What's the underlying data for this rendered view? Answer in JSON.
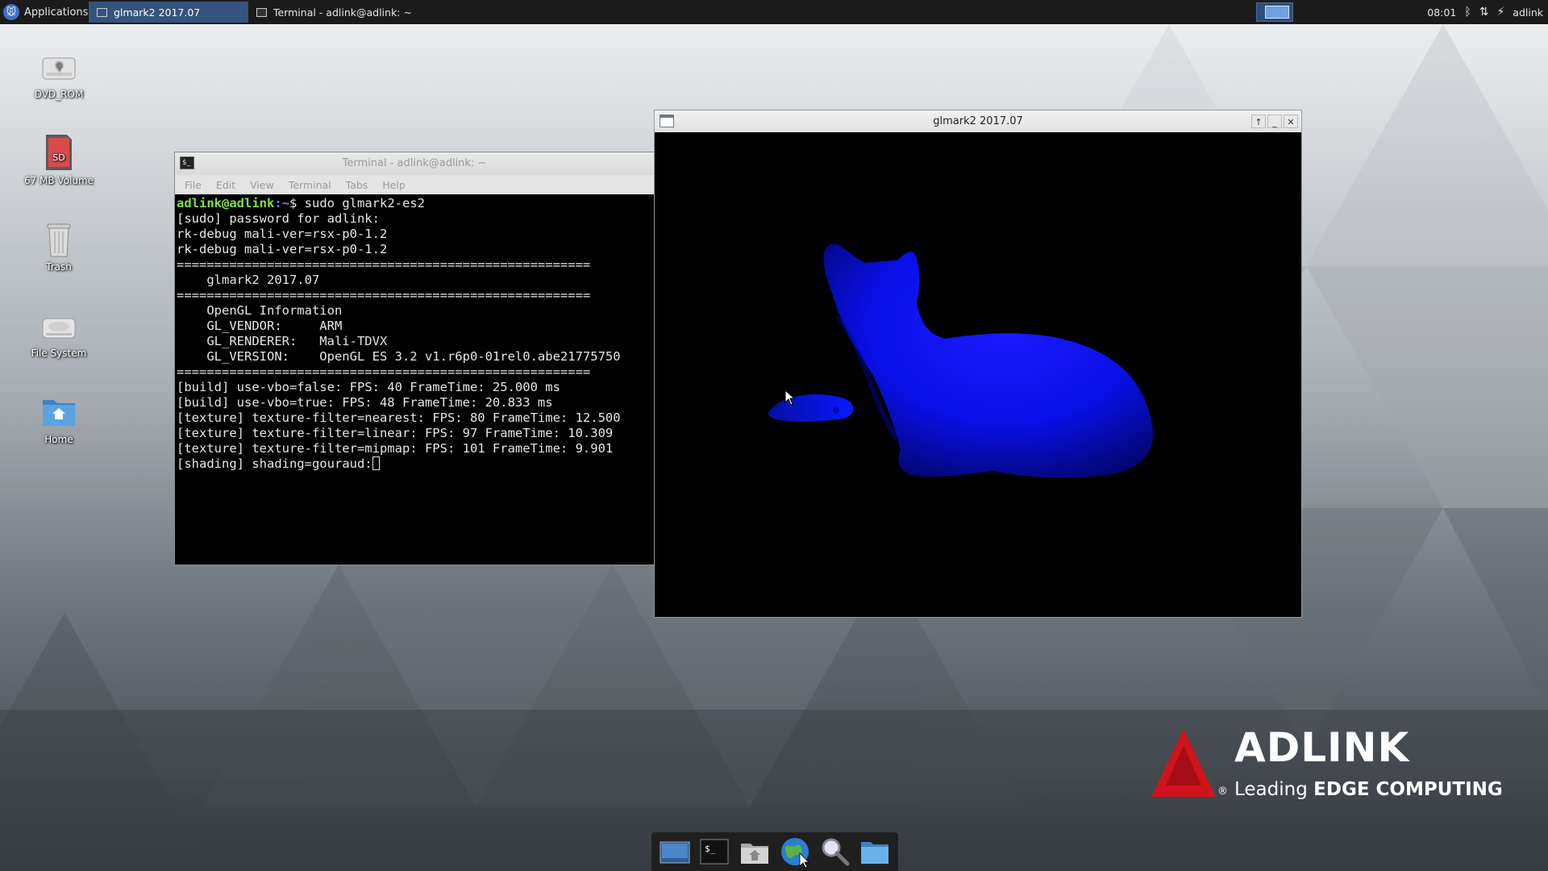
{
  "colors": {
    "panel_bg": "#1b1b1b",
    "active_task": "#35537e",
    "prompt_user": "#7fe04a",
    "prompt_path": "#5e8ff0",
    "cat_blue": "#0a10ff",
    "logo_red": "#d0141c"
  },
  "top_panel": {
    "applications_label": "Applications",
    "tasks": [
      {
        "label": "glmark2 2017.07"
      },
      {
        "label": "Terminal - adlink@adlink: ~"
      }
    ],
    "clock": "08:01",
    "user": "adlink"
  },
  "desktop_icons": [
    {
      "label": "DVD_ROM",
      "icon": "dvd-rom-icon"
    },
    {
      "label": "67 MB Volume",
      "icon": "sd-card-icon"
    },
    {
      "label": "Trash",
      "icon": "trash-icon"
    },
    {
      "label": "File System",
      "icon": "hard-drive-icon"
    },
    {
      "label": "Home",
      "icon": "home-folder-icon"
    }
  ],
  "terminal": {
    "title": "Terminal - adlink@adlink: ~",
    "menu": [
      "File",
      "Edit",
      "View",
      "Terminal",
      "Tabs",
      "Help"
    ],
    "prompt_user": "adlink@adlink",
    "prompt_path": ":~",
    "prompt_symbol": "$ ",
    "command": "sudo glmark2-es2",
    "lines": [
      "[sudo] password for adlink:",
      "rk-debug mali-ver=rsx-p0-1.2",
      "rk-debug mali-ver=rsx-p0-1.2",
      "=======================================================",
      "    glmark2 2017.07",
      "=======================================================",
      "    OpenGL Information",
      "    GL_VENDOR:     ARM",
      "    GL_RENDERER:   Mali-TDVX",
      "    GL_VERSION:    OpenGL ES 3.2 v1.r6p0-01rel0.abe21775750",
      "=======================================================",
      "[build] use-vbo=false: FPS: 40 FrameTime: 25.000 ms",
      "[build] use-vbo=true: FPS: 48 FrameTime: 20.833 ms",
      "[texture] texture-filter=nearest: FPS: 80 FrameTime: 12.500",
      "[texture] texture-filter=linear: FPS: 97 FrameTime: 10.309",
      "[texture] texture-filter=mipmap: FPS: 101 FrameTime: 9.901"
    ],
    "current_line": "[shading] shading=gouraud:"
  },
  "glmark": {
    "title": "glmark2 2017.07",
    "buttons": {
      "up": "↑",
      "minimize": "_",
      "close": "✕"
    }
  },
  "dock": {
    "items": [
      {
        "icon": "show-desktop-icon"
      },
      {
        "icon": "terminal-icon"
      },
      {
        "icon": "file-manager-icon"
      },
      {
        "icon": "web-browser-icon"
      },
      {
        "icon": "app-finder-icon"
      },
      {
        "icon": "folder-icon"
      }
    ]
  },
  "logo": {
    "name": "ADLINK",
    "tagline_prefix": "Leading ",
    "tagline_bold": "EDGE COMPUTING",
    "registered": "®"
  }
}
